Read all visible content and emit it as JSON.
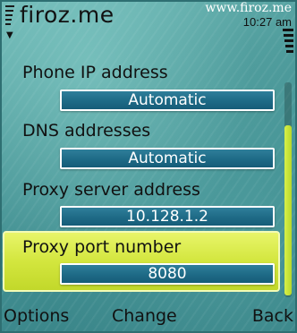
{
  "header": {
    "title": "firoz.me",
    "watermark": "www.firoz.me",
    "clock": "10:27 am"
  },
  "settings": [
    {
      "label": "Phone IP address",
      "value": "Automatic"
    },
    {
      "label": "DNS addresses",
      "value": "Automatic"
    },
    {
      "label": "Proxy server address",
      "value": "10.128.1.2"
    },
    {
      "label": "Proxy port number",
      "value": "8080",
      "selected": true
    }
  ],
  "softkeys": {
    "left": "Options",
    "center": "Change",
    "right": "Back"
  },
  "colors": {
    "background": "#4f9c9c",
    "highlight": "#d3e63e",
    "value_box": "#1e6a86",
    "scroll_thumb": "#c8e23a"
  },
  "icons": {
    "signal": "signal-strength-icon",
    "battery": "battery-level-icon",
    "antenna": "antenna-icon"
  }
}
